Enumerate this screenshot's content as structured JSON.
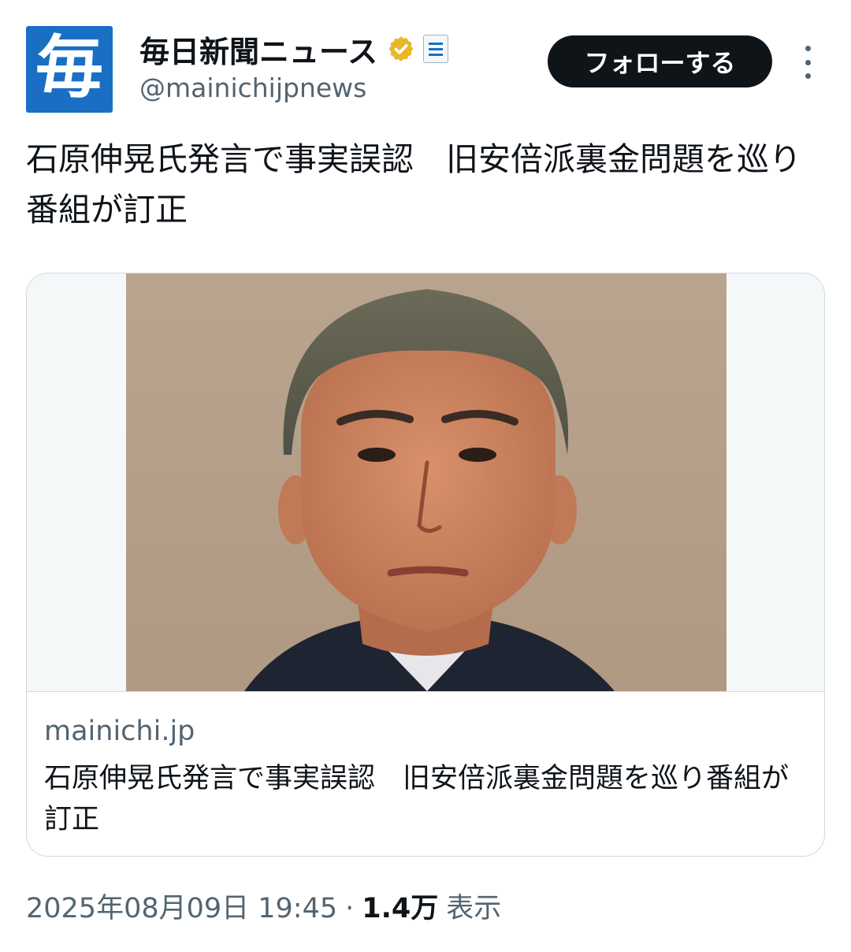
{
  "account": {
    "avatar_char": "毎",
    "display_name": "毎日新聞ニュース",
    "handle": "@mainichijpnews",
    "verified_badge_icon": "gold-verified-badge-icon",
    "affiliation_icon": "mainichi-affiliate-icon"
  },
  "follow_label": "フォローする",
  "more_icon": "more-vertical-icon",
  "tweet": {
    "text": "石原伸晃氏発言で事実誤認　旧安倍派裏金問題を巡り番組が訂正"
  },
  "card": {
    "image_icon": "portrait-photo",
    "domain": "mainichi.jp",
    "title": "石原伸晃氏発言で事実誤認　旧安倍派裏金問題を巡り番組が訂正"
  },
  "meta": {
    "timestamp": "2025年08月09日 19:45",
    "separator": "·",
    "views_count": "1.4万",
    "views_label": "表示"
  },
  "colors": {
    "brand_blue": "#1a6fc4",
    "badge_gold": "#e8b829",
    "text_primary": "#0f1419",
    "text_secondary": "#536471",
    "border": "#cfd9de"
  }
}
